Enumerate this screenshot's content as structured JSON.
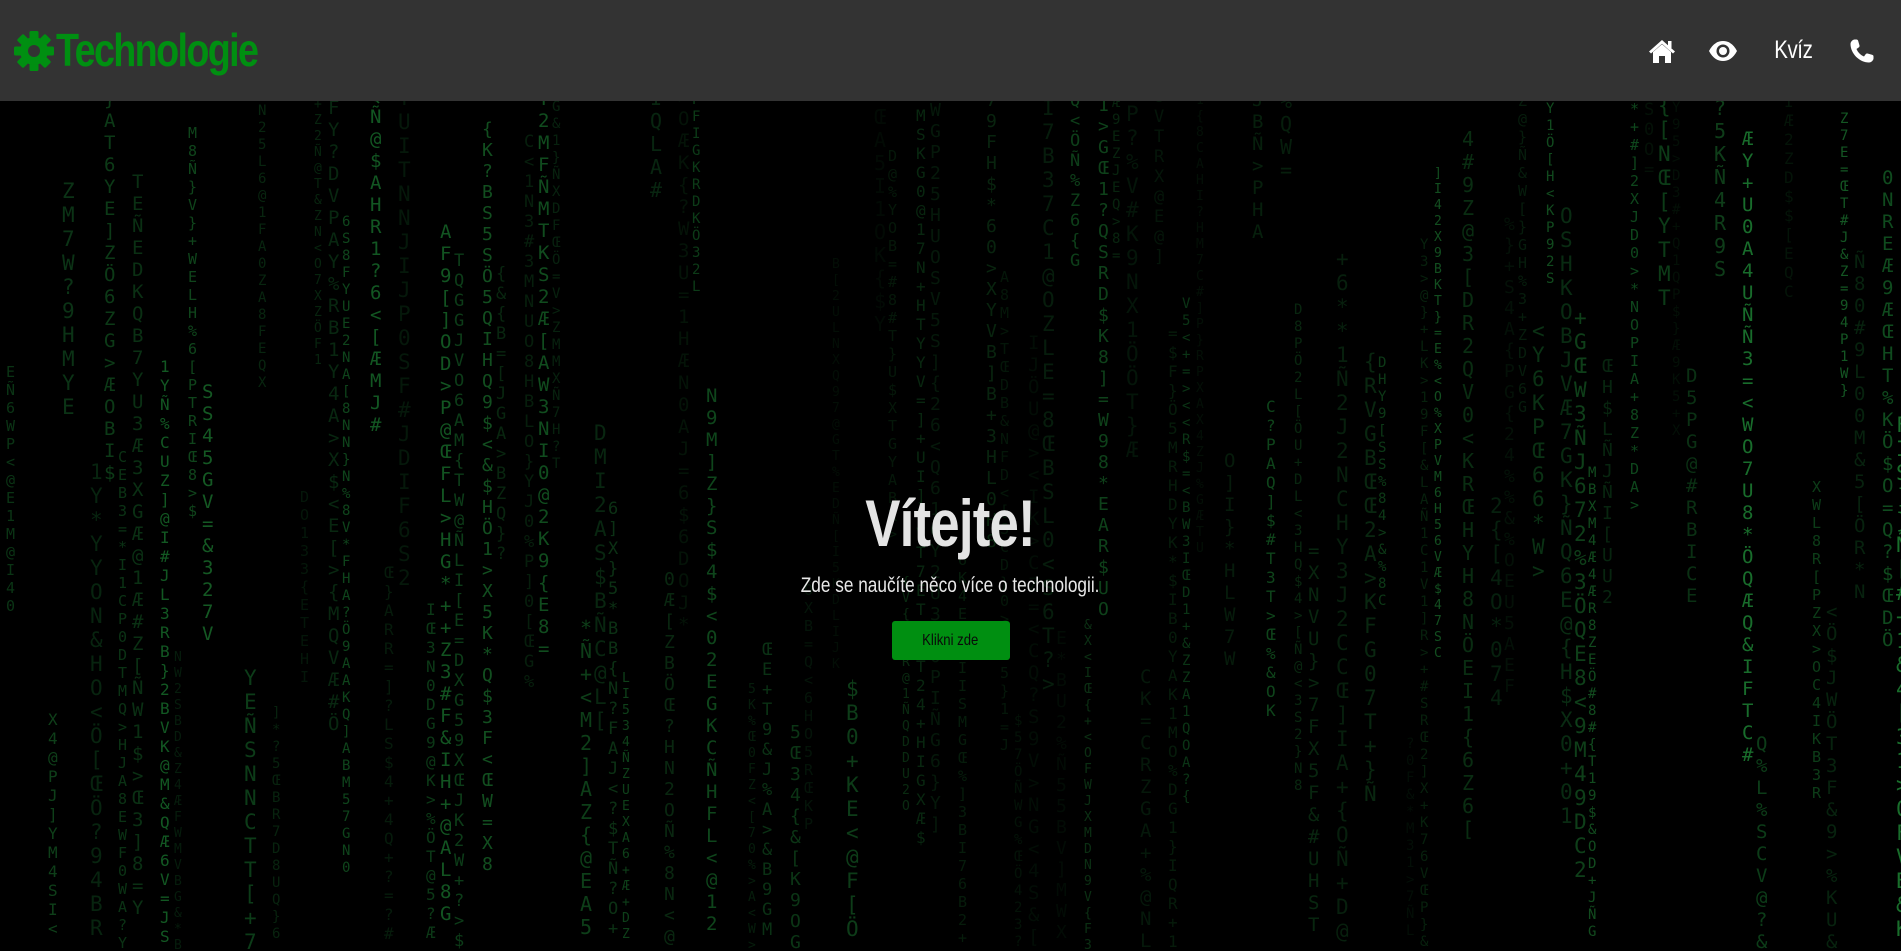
{
  "colors": {
    "brand": "#008f11",
    "navbar_bg": "#333333",
    "nav_text": "#ffffff",
    "hero_title": "#e4e4e4",
    "button_bg": "#008f11"
  },
  "navbar": {
    "brand_icon": "gear-icon",
    "brand_name": "Technologie",
    "links": [
      {
        "icon": "home-icon"
      },
      {
        "icon": "eye-icon"
      },
      {
        "label": "Kvíz"
      },
      {
        "icon": "phone-icon"
      }
    ]
  },
  "hero": {
    "title": "Vítejte!",
    "subtitle": "Zde se naučíte něco více o technologii.",
    "button_label": "Klikni zde"
  }
}
